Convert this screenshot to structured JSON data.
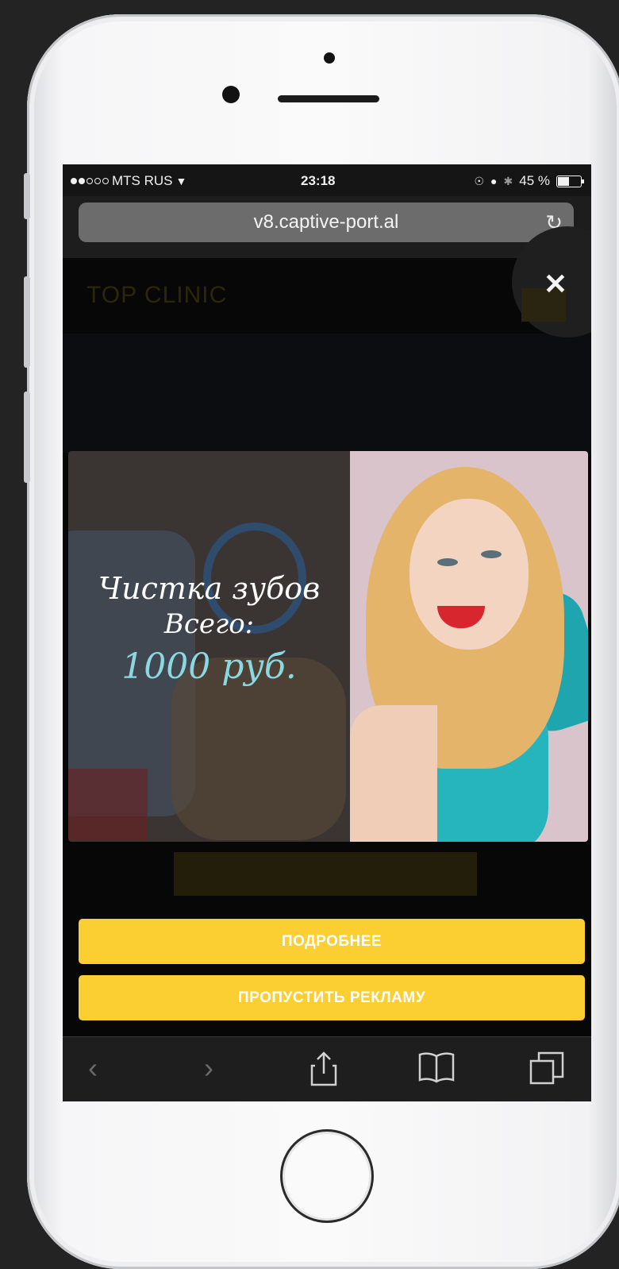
{
  "status_bar": {
    "carrier": "MTS RUS",
    "time": "23:18",
    "battery": "45 %",
    "battery_level": 0.45
  },
  "browser": {
    "url": "v8.captive-port.al",
    "reload_icon": "reload-icon"
  },
  "site": {
    "logo_text": "TOP CLINIC"
  },
  "ad": {
    "line1": "Чистка зубов",
    "line2": "Всего:",
    "price": "1000 руб."
  },
  "buttons": {
    "details": "ПОДРОБНЕЕ",
    "skip": "ПРОПУСТИТЬ РЕКЛАМУ"
  },
  "toolbar": {
    "items": [
      "back-icon",
      "forward-icon",
      "share-icon",
      "bookmarks-icon",
      "tabs-icon"
    ]
  },
  "colors": {
    "accent": "#fbcf32",
    "price": "#8bd8e1"
  }
}
